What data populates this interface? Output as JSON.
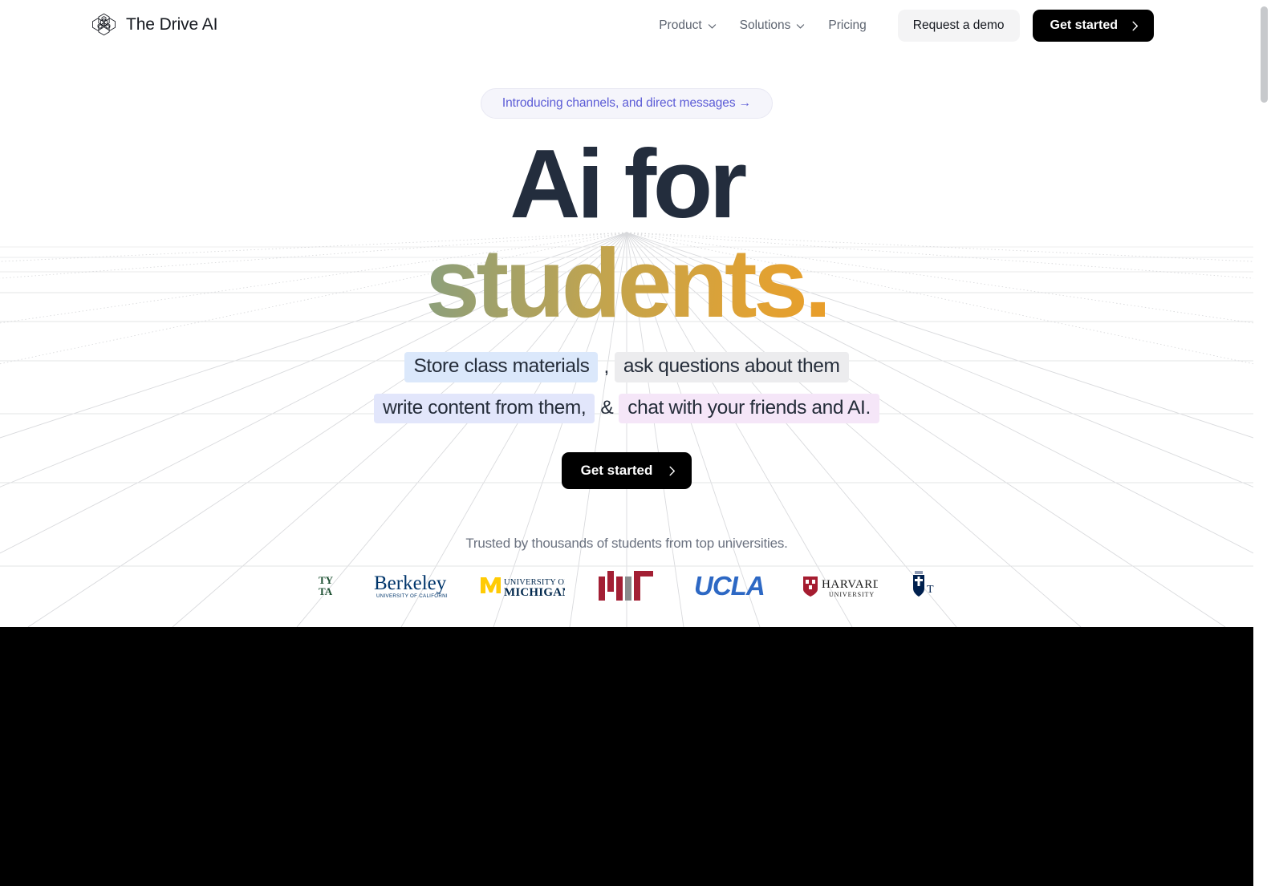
{
  "header": {
    "brand_name": "The Drive AI",
    "brand_logo_icon": "drive-ai-hex-cluster-logo",
    "nav": [
      {
        "label": "Product",
        "icon": "chevron-down-icon",
        "has_dropdown": true
      },
      {
        "label": "Solutions",
        "icon": "chevron-down-icon",
        "has_dropdown": true
      },
      {
        "label": "Pricing",
        "icon": "",
        "has_dropdown": false
      }
    ],
    "demo_button": "Request a demo",
    "get_started_button": "Get started",
    "get_started_icon": "chevron-right-icon"
  },
  "hero": {
    "badge": "Introducing channels, and direct messages →",
    "headline_line1": "Ai for",
    "headline_line2": "students.",
    "sub_line1_a": "Store class materials",
    "sub_line1_comma": ",",
    "sub_line1_b": "ask questions about them",
    "sub_line2_a": "write content from them,",
    "sub_line2_amp": "&",
    "sub_line2_b": "chat with your friends and AI.",
    "cta_button": "Get started",
    "cta_icon": "chevron-right-icon"
  },
  "social_proof": {
    "caption": "Trusted by thousands of students from top universities.",
    "logos": [
      {
        "name": "university-partial-ty-ta",
        "text_top": "TY",
        "text_bottom": "TA"
      },
      {
        "name": "uc-berkeley",
        "wordmark": "Berkeley",
        "subtext": "UNIVERSITY OF CALIFORNIA"
      },
      {
        "name": "university-of-michigan",
        "line1": "UNIVERSITY OF",
        "line2": "MICHIGAN",
        "monogram": "M"
      },
      {
        "name": "mit",
        "wordmark": "MIT"
      },
      {
        "name": "ucla",
        "wordmark": "UCLA"
      },
      {
        "name": "harvard-university",
        "line1": "HARVARD",
        "line2": "UNIVERSITY"
      },
      {
        "name": "university-of-toronto",
        "wordmark": "T"
      }
    ]
  },
  "colors": {
    "headline_dark": "#232d3d",
    "gradient_start": "#3b82d6",
    "gradient_end": "#ea5c2c",
    "badge_text": "#5b5bd6",
    "badge_bg": "#f5f5fb",
    "cta_bg": "#000000",
    "demo_bg": "#f4f4f5",
    "hl_blue": "#dbe8fb",
    "hl_gray": "#ececee",
    "hl_indigo": "#e2e6fb",
    "hl_pink": "#f5e6f8",
    "berkeley_blue": "#00356b",
    "michigan_blue": "#00274c",
    "michigan_maize": "#ffcb05",
    "mit_red": "#a31f34",
    "ucla_blue": "#2d68c4",
    "harvard_crimson": "#a51c30",
    "toronto_blue": "#00204e",
    "dark_panel": "#000000"
  },
  "scrollbar": {
    "name": "vertical-scrollbar",
    "position": "top"
  }
}
